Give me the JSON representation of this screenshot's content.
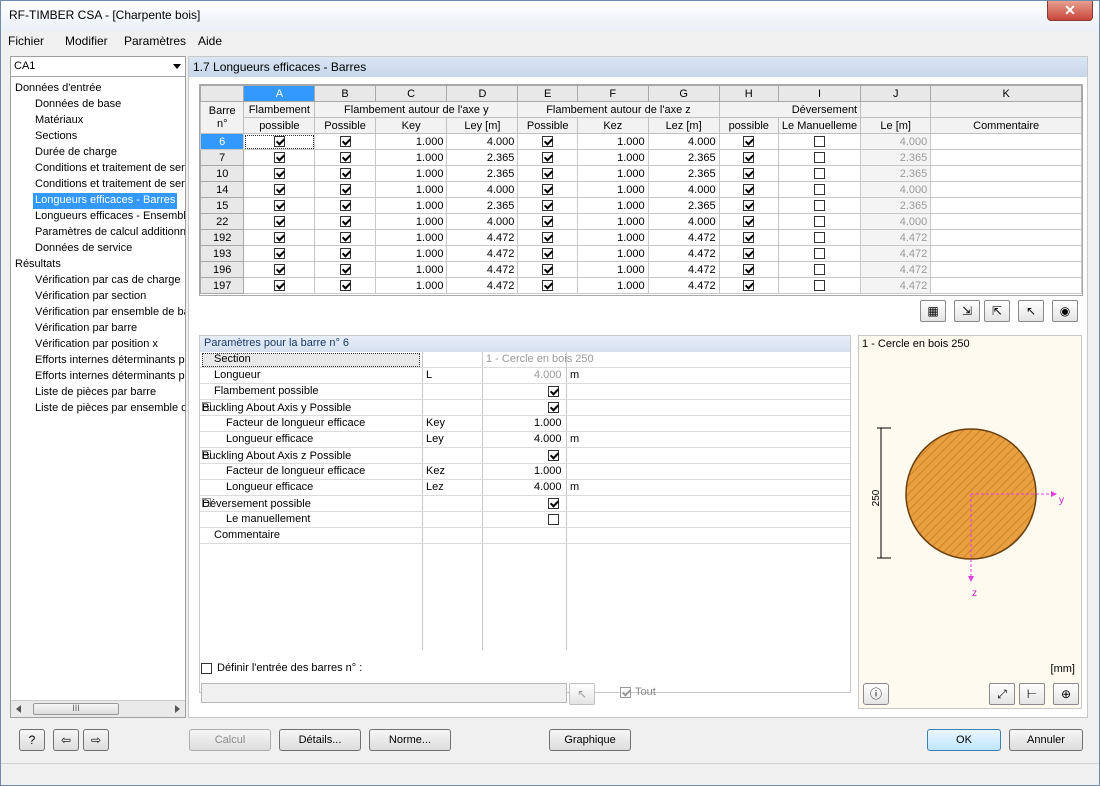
{
  "window": {
    "title": "RF-TIMBER CSA - [Charpente bois]",
    "close": "✕"
  },
  "menu": {
    "items": [
      "Fichier",
      "Modifier",
      "Paramètres",
      "Aide"
    ]
  },
  "case": {
    "selected": "CA1"
  },
  "tree": {
    "input_root": "Données d'entrée",
    "input_items": [
      "Données de base",
      "Matériaux",
      "Sections",
      "Durée de charge",
      "Conditions et traitement de ser",
      "Conditions et traitement de ser",
      "Longueurs efficaces - Barres",
      "Longueurs efficaces - Ensemble",
      "Paramètres de calcul additionne",
      "Données de service"
    ],
    "results_root": "Résultats",
    "results_items": [
      "Vérification par cas de charge",
      "Vérification par section",
      "Vérification par ensemble de ba",
      "Vérification par barre",
      "Vérification par position x",
      "Efforts internes déterminants p",
      "Efforts internes déterminants p",
      "Liste de pièces par barre",
      "Liste de pièces par ensemble de"
    ],
    "scroll_thumb": "III"
  },
  "section_title": "1.7 Longueurs efficaces - Barres",
  "grid": {
    "col_letters": [
      "A",
      "B",
      "C",
      "D",
      "E",
      "F",
      "G",
      "H",
      "I",
      "J",
      "K"
    ],
    "h_barre": "Barre n°",
    "h_flambement": "Flambement",
    "h_possible_lc": "possible",
    "h_group_y": "Flambement autour de l'axe y",
    "h_group_z": "Flambement autour de l'axe z",
    "h_deversement": "Déversement",
    "h_possible": "Possible",
    "h_key": "Key",
    "h_ley": "Ley [m]",
    "h_kez": "Kez",
    "h_lez": "Lez [m]",
    "h_le_manuel": "Le Manuelleme",
    "h_le": "Le [m]",
    "h_comment": "Commentaire",
    "rows": [
      {
        "n": "6",
        "key": "1.000",
        "ley": "4.000",
        "kez": "1.000",
        "lez": "4.000",
        "le": "4.000"
      },
      {
        "n": "7",
        "key": "1.000",
        "ley": "2.365",
        "kez": "1.000",
        "lez": "2.365",
        "le": "2.365"
      },
      {
        "n": "10",
        "key": "1.000",
        "ley": "2.365",
        "kez": "1.000",
        "lez": "2.365",
        "le": "2.365"
      },
      {
        "n": "14",
        "key": "1.000",
        "ley": "4.000",
        "kez": "1.000",
        "lez": "4.000",
        "le": "4.000"
      },
      {
        "n": "15",
        "key": "1.000",
        "ley": "2.365",
        "kez": "1.000",
        "lez": "2.365",
        "le": "2.365"
      },
      {
        "n": "22",
        "key": "1.000",
        "ley": "4.000",
        "kez": "1.000",
        "lez": "4.000",
        "le": "4.000"
      },
      {
        "n": "192",
        "key": "1.000",
        "ley": "4.472",
        "kez": "1.000",
        "lez": "4.472",
        "le": "4.472"
      },
      {
        "n": "193",
        "key": "1.000",
        "ley": "4.472",
        "kez": "1.000",
        "lez": "4.472",
        "le": "4.472"
      },
      {
        "n": "196",
        "key": "1.000",
        "ley": "4.472",
        "kez": "1.000",
        "lez": "4.472",
        "le": "4.472"
      },
      {
        "n": "197",
        "key": "1.000",
        "ley": "4.472",
        "kez": "1.000",
        "lez": "4.472",
        "le": "4.472"
      }
    ]
  },
  "params": {
    "title": "Paramètres pour la barre n° 6",
    "section_label": "Section",
    "section_value": "1 - Cercle en bois 250",
    "length_label": "Longueur",
    "length_sym": "L",
    "length_value": "4.000",
    "length_unit": "m",
    "flamb_label": "Flambement possible",
    "buck_y": "Buckling About Axis y Possible",
    "facteur_label": "Facteur de longueur efficace",
    "key_sym": "Key",
    "key_value": "1.000",
    "leff_label": "Longueur efficace",
    "ley_sym": "Ley",
    "ley_value": "4.000",
    "unit_m": "m",
    "buck_z": "Buckling About Axis z Possible",
    "kez_sym": "Kez",
    "kez_value": "1.000",
    "lez_sym": "Lez",
    "lez_value": "4.000",
    "dever_label": "Déversement possible",
    "le_manuel_label": "Le manuellement",
    "comment_label": "Commentaire"
  },
  "define": {
    "label": "Définir l'entrée des barres n° :",
    "tout": "Tout"
  },
  "preview": {
    "title": "1 - Cercle en bois 250",
    "dim": "250",
    "axis_y": "y",
    "axis_z": "z",
    "unit": "[mm]",
    "fill_color": "#e8a040"
  },
  "buttons": {
    "calcul": "Calcul",
    "details": "Détails...",
    "norme": "Norme...",
    "graphique": "Graphique",
    "ok": "OK",
    "annuler": "Annuler"
  }
}
